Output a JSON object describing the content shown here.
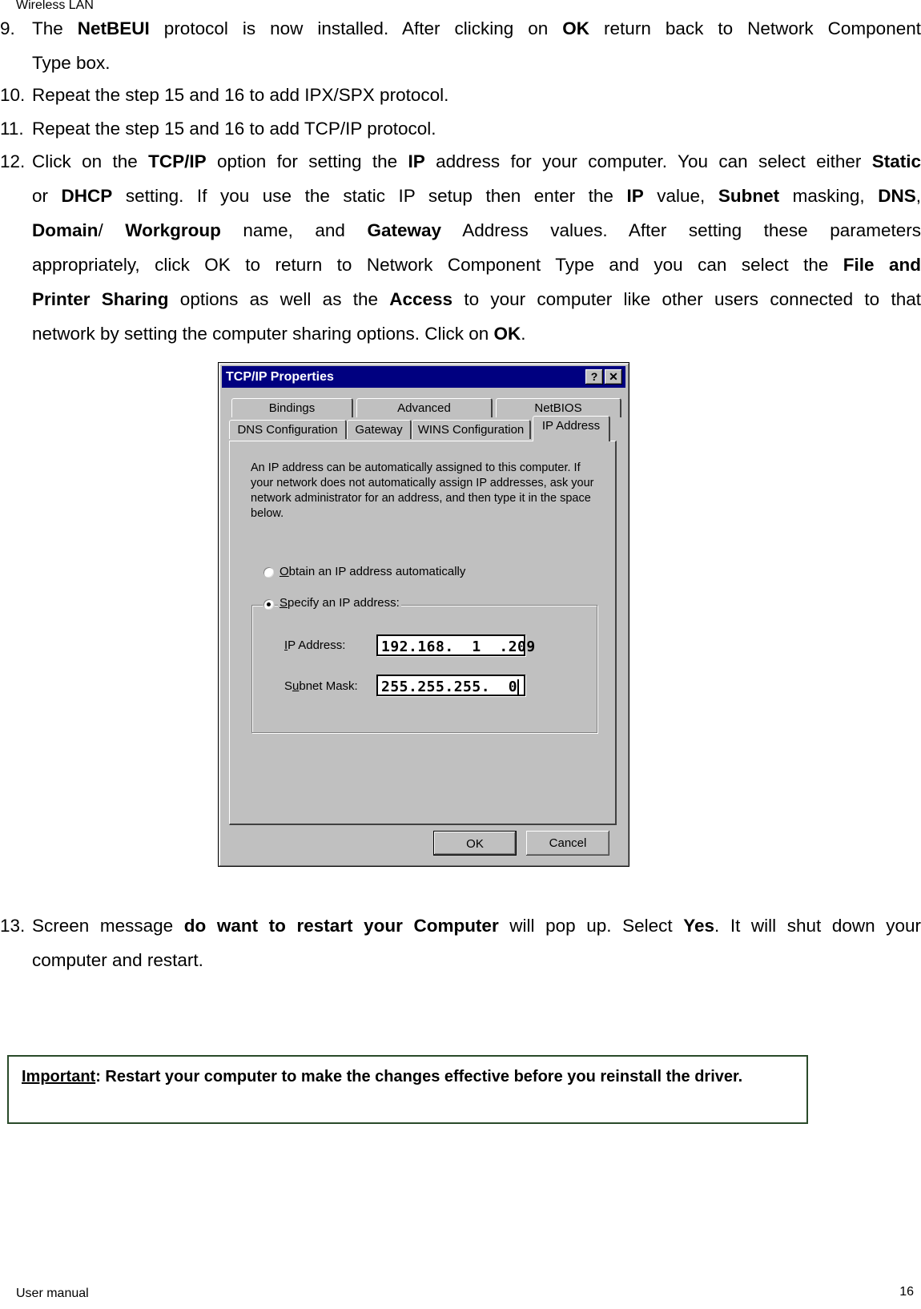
{
  "header": {
    "title": "Wireless LAN"
  },
  "steps": [
    {
      "num": "9.",
      "parts": [
        "The ",
        "NetBEUI",
        " protocol is now installed. After clicking on ",
        "OK",
        " return back to Network Component"
      ],
      "line2": "Type box."
    },
    {
      "num": "10.",
      "text": "Repeat the step 15 and 16 to add IPX/SPX protocol."
    },
    {
      "num": "11.",
      "text": "Repeat the step 15 and 16 to add TCP/IP protocol."
    },
    {
      "num": "12.",
      "l1": [
        "Click on the ",
        "TCP/IP",
        " option for setting the ",
        "IP",
        " address for your computer. You can select either ",
        "Static"
      ],
      "l2": [
        "or ",
        "DHCP",
        " setting. If you use the static IP setup then enter the ",
        "IP",
        " value, ",
        "Subnet",
        " masking, ",
        "DNS",
        ","
      ],
      "l3": [
        "Domain",
        "/ ",
        "Workgroup",
        " name, and ",
        "Gateway",
        " Address values. After setting these parameters"
      ],
      "l4": [
        "appropriately, click OK to return to Network Component Type and you can select the ",
        "File and"
      ],
      "l5": [
        "Printer Sharing",
        " options as well as the ",
        "Access",
        " to your computer like other users connected to that"
      ],
      "l6": [
        "network by setting the computer sharing options. Click on ",
        "OK",
        "."
      ]
    },
    {
      "num": "13.",
      "l1": [
        "Screen message ",
        "do want to restart your Computer",
        " will pop up. Select ",
        "Yes",
        ". It will shut down your"
      ],
      "l2": "computer and restart."
    }
  ],
  "dialog": {
    "title": "TCP/IP Properties",
    "help_btn": "?",
    "close_btn": "✕",
    "tabs_back": [
      "Bindings",
      "Advanced",
      "NetBIOS"
    ],
    "tabs_front": [
      "DNS Configuration",
      "Gateway",
      "WINS Configuration",
      "IP Address"
    ],
    "active_tab": "IP Address",
    "description": "An IP address can be automatically assigned to this computer. If your network does not automatically assign IP addresses, ask your network administrator for an address, and then type it in the space below.",
    "radio_auto": {
      "accel": "O",
      "rest": "btain an IP address automatically",
      "checked": false
    },
    "radio_specify": {
      "accel": "S",
      "rest": "pecify an IP address:",
      "checked": true
    },
    "ip_label": {
      "accel": "I",
      "rest": "P Address:"
    },
    "ip_value": "192.168.  1  .209",
    "subnet_label": {
      "pre": "S",
      "accel": "u",
      "rest": "bnet Mask:"
    },
    "subnet_value": "255.255.255.  0",
    "ok": "OK",
    "cancel": "Cancel"
  },
  "important": {
    "label": "Important",
    "text": ": Restart your computer to make the changes effective before you reinstall the driver."
  },
  "footer": {
    "left": "User manual",
    "page": "16"
  }
}
